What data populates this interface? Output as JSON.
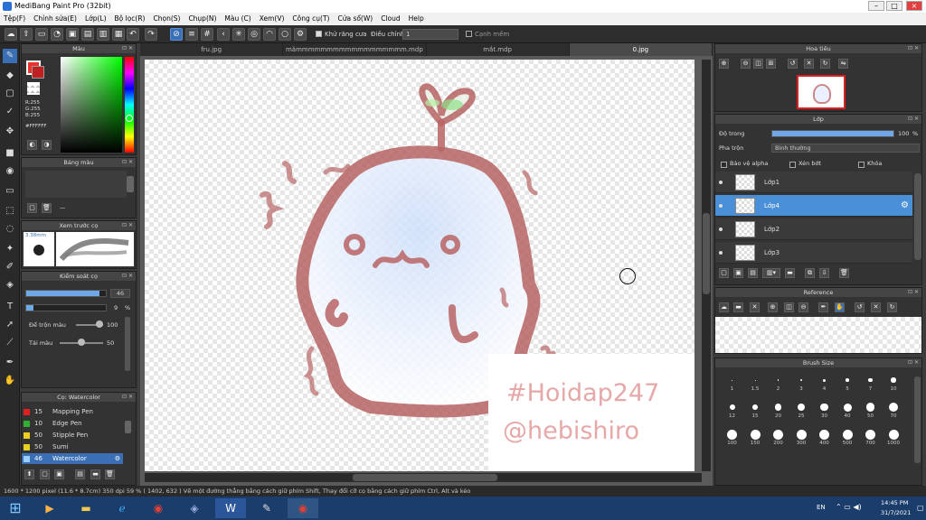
{
  "window": {
    "title": "MediBang Paint Pro (32bit)"
  },
  "menu": [
    "Tệp(F)",
    "Chỉnh sửa(E)",
    "Lớp(L)",
    "Bộ lọc(R)",
    "Chọn(S)",
    "Chụp(N)",
    "Màu (C)",
    "Xem(V)",
    "Công cụ(T)",
    "Cửa sổ(W)",
    "Cloud",
    "Help"
  ],
  "toolbar": {
    "antialias_label": "Khử răng cưa",
    "correction_label": "Điều chỉnh",
    "correction_value": "1",
    "smooth_label": "Cạnh mềm"
  },
  "tabs": [
    {
      "label": "fru.jpg",
      "active": false
    },
    {
      "label": "mămmmmmmmmmmmmmmmmmm.mdp",
      "active": false
    },
    {
      "label": "mắt.mdp",
      "active": false
    },
    {
      "label": "0.jpg",
      "active": true
    }
  ],
  "color_panel": {
    "title": "Màu",
    "foreground": "#e8342c",
    "rgb_r": "R:255",
    "rgb_g": "G:255",
    "rgb_b": "B:255",
    "hex": "#FFFFFF"
  },
  "palette_panel": {
    "title": "Bảng màu"
  },
  "preview_panel": {
    "title": "Xem trước cọ",
    "size": "3.38mm"
  },
  "brush_control": {
    "title": "Kiểm soát cọ",
    "size_value": "46",
    "size_fraction": 0.92,
    "opacity_value": "9",
    "opacity_unit": "%",
    "opacity_fraction": 0.09,
    "blend_label": "Để trộn màu",
    "blend_value": "100",
    "reload_label": "Tải màu",
    "reload_value": "50"
  },
  "brush_list": {
    "title": "Cọ: Watercolor",
    "items": [
      {
        "size": "15",
        "name": "Mapping Pen",
        "color": "#e02020"
      },
      {
        "size": "10",
        "name": "Edge Pen",
        "color": "#30b030"
      },
      {
        "size": "50",
        "name": "Stipple Pen",
        "color": "#e8d020"
      },
      {
        "size": "50",
        "name": "Sumi",
        "color": "#e8d020"
      },
      {
        "size": "46",
        "name": "Watercolor",
        "color": "#4aa0e8",
        "selected": true
      }
    ]
  },
  "navigator": {
    "title": "Hoa tiêu"
  },
  "layer_panel": {
    "title": "Lớp",
    "opacity_label": "Độ trong",
    "opacity_value": "100",
    "opacity_unit": "%",
    "blend_label": "Pha trộn",
    "blend_value": "Bình thường",
    "protect_alpha": "Bảo vệ alpha",
    "clipping": "Xén bớt",
    "lock": "Khóa",
    "layers": [
      {
        "name": "Lớp1",
        "selected": false
      },
      {
        "name": "Lớp4",
        "selected": true
      },
      {
        "name": "Lớp2",
        "selected": false
      },
      {
        "name": "Lớp3",
        "selected": false
      }
    ]
  },
  "reference_panel": {
    "title": "Reference"
  },
  "brush_size_panel": {
    "title": "Brush Size",
    "rows": [
      [
        "1",
        "1.5",
        "2",
        "3",
        "4",
        "5",
        "7",
        "10"
      ],
      [
        "12",
        "15",
        "20",
        "25",
        "30",
        "40",
        "50",
        "70"
      ],
      [
        "100",
        "150",
        "200",
        "300",
        "400",
        "500",
        "700",
        "1000"
      ]
    ]
  },
  "artwork": {
    "hashtag": "#Hoidap247",
    "handle": "@hebishiro",
    "line_color": "#b86464"
  },
  "status": {
    "text": "1600 * 1200 pixel  (11.6 * 8.7cm)  350 dpi  59 %  ( 1402, 632 )  Vẽ một đường thẳng bằng cách giữ phím Shift, Thay đổi cỡ cọ bằng cách giữ phím Ctrl, Alt và kéo"
  },
  "taskbar": {
    "lang": "EN",
    "time": "14:45 PM",
    "date": "31/7/2021"
  }
}
